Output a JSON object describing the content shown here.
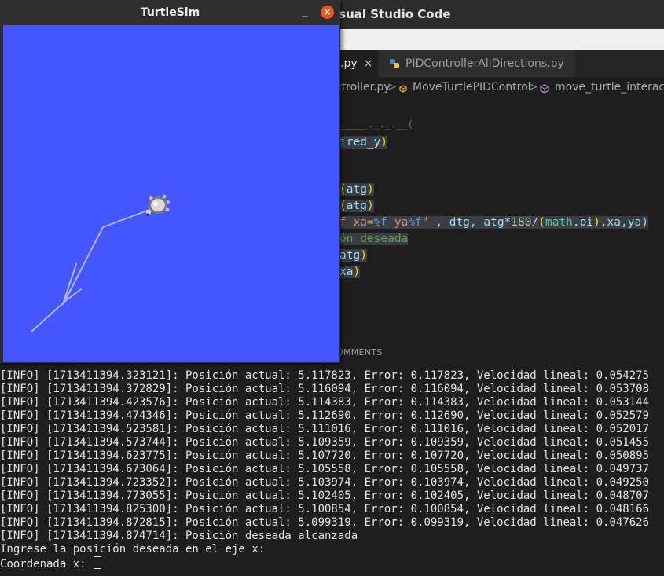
{
  "vscode": {
    "title_fragment": "isual Studio Code",
    "tabs": [
      {
        "label": ".py",
        "close": "×"
      },
      {
        "label": "PIDControllerAllDirections.py"
      }
    ],
    "breadcrumb": {
      "file": "ctroller.py",
      "sep": ">",
      "class": "MoveTurtlePIDControl",
      "method": "move_turtle_interactiv"
    },
    "code": {
      "l1": "_____._._.__(",
      "l2a": "ired_y",
      "l2b": ")",
      "l3a": "(",
      "l3b": "atg",
      "l3c": ")",
      "l4a": "(",
      "l4b": "atg",
      "l4c": ")",
      "l5a": "f xa=",
      "l5b": "%f",
      "l5c": " ya",
      "l5d": "%f",
      "l5e": "\"",
      "l5f": " , dtg, atg*",
      "l5g": "180",
      "l5h": "/",
      "l5i": "(",
      "l5j": "math",
      "l5k": ".",
      "l5l": "pi",
      "l5m": ")",
      "l5n": ",xa,ya)",
      "l6": "ón deseada",
      "l7a": "atg",
      "l7b": ")",
      "l8a": "xa",
      "l8b": ")"
    },
    "panel_tab": "OMMENTS",
    "terminal_lines": [
      "[INFO] [1713411394.323121]: Posición actual: 5.117823, Error: 0.117823, Velocidad lineal: 0.054275",
      "[INFO] [1713411394.372829]: Posición actual: 5.116094, Error: 0.116094, Velocidad lineal: 0.053708",
      "[INFO] [1713411394.423576]: Posición actual: 5.114383, Error: 0.114383, Velocidad lineal: 0.053144",
      "[INFO] [1713411394.474346]: Posición actual: 5.112690, Error: 0.112690, Velocidad lineal: 0.052579",
      "[INFO] [1713411394.523581]: Posición actual: 5.111016, Error: 0.111016, Velocidad lineal: 0.052017",
      "[INFO] [1713411394.573744]: Posición actual: 5.109359, Error: 0.109359, Velocidad lineal: 0.051455",
      "[INFO] [1713411394.623775]: Posición actual: 5.107720, Error: 0.107720, Velocidad lineal: 0.050895",
      "[INFO] [1713411394.673064]: Posición actual: 5.105558, Error: 0.105558, Velocidad lineal: 0.049737",
      "[INFO] [1713411394.723352]: Posición actual: 5.103974, Error: 0.103974, Velocidad lineal: 0.049250",
      "[INFO] [1713411394.773055]: Posición actual: 5.102405, Error: 0.102405, Velocidad lineal: 0.048707",
      "[INFO] [1713411394.825300]: Posición actual: 5.100854, Error: 0.100854, Velocidad lineal: 0.048166",
      "[INFO] [1713411394.872815]: Posición actual: 5.099319, Error: 0.099319, Velocidad lineal: 0.047626",
      "[INFO] [1713411394.874714]: Posición deseada alcanzada",
      "Ingrese la posición deseada en el eje x:",
      "Coordenada x: "
    ]
  },
  "turtlesim": {
    "title": "TurtleSim",
    "minimize": "_",
    "close": "×",
    "background_color": "#4556ff",
    "trail_color": "#b3b6ff"
  }
}
